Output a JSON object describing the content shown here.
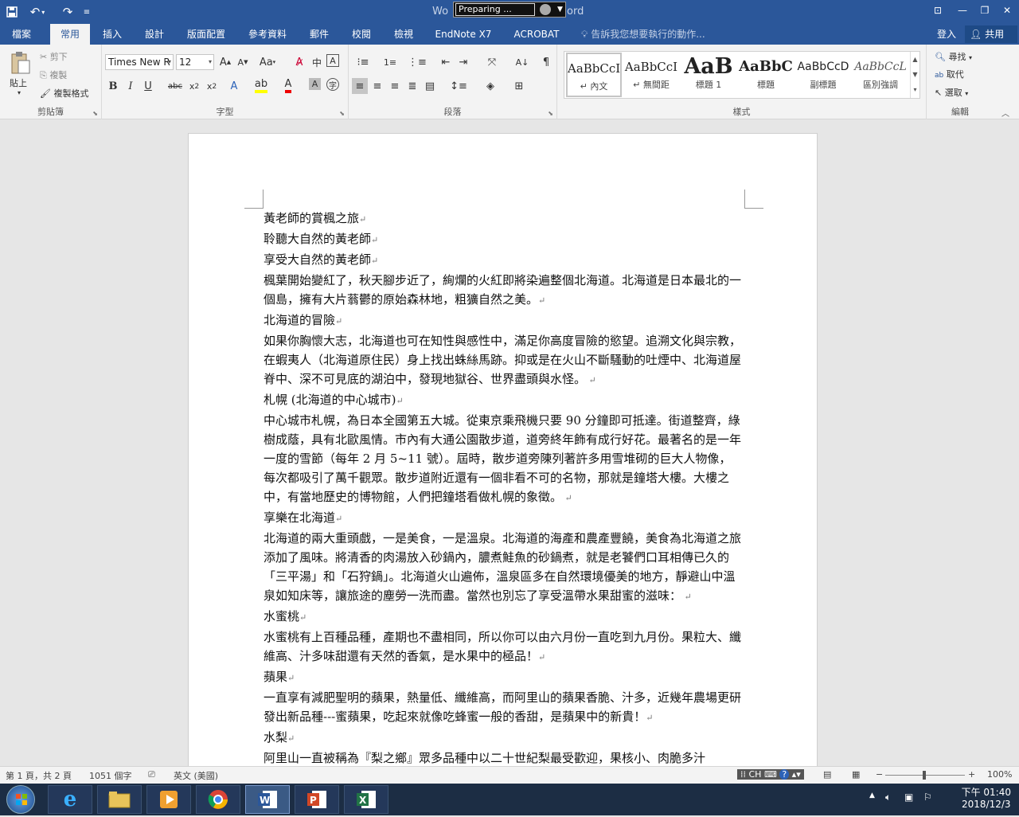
{
  "titlebar": {
    "title_left": "Wo",
    "title_right": "ord",
    "preparing": "Preparing ..."
  },
  "tabs": [
    "檔案",
    "常用",
    "插入",
    "設計",
    "版面配置",
    "參考資料",
    "郵件",
    "校閱",
    "檢視",
    "EndNote X7",
    "ACROBAT"
  ],
  "tell_me": "告訴我您想要執行的動作...",
  "sign_in": "登入",
  "share": "共用",
  "ribbon": {
    "clipboard": {
      "paste": "貼上",
      "cut": "剪下",
      "copy": "複製",
      "format_painter": "複製格式",
      "label": "剪貼簿"
    },
    "font": {
      "name": "Times New R",
      "size": "12",
      "label": "字型"
    },
    "paragraph": {
      "label": "段落"
    },
    "styles": {
      "label": "樣式",
      "items": [
        {
          "preview": "AaBbCcI",
          "name": "↵ 內文"
        },
        {
          "preview": "AaBbCcI",
          "name": "↵ 無間距"
        },
        {
          "preview": "AaB",
          "name": "標題 1"
        },
        {
          "preview": "AaBbC",
          "name": "標題"
        },
        {
          "preview": "AaBbCcD",
          "name": "副標題"
        },
        {
          "preview": "AaBbCcL",
          "name": "區別強調"
        }
      ]
    },
    "editing": {
      "find": "尋找",
      "replace": "取代",
      "select": "選取",
      "label": "編輯"
    }
  },
  "document": {
    "paragraphs": [
      "黃老師的賞楓之旅",
      "聆聽大自然的黃老師",
      "享受大自然的黃老師",
      "楓葉開始變紅了，秋天腳步近了，絢爛的火紅即將染遍整個北海道。北海道是日本最北的一個島，擁有大片蓊鬱的原始森林地，粗獷自然之美。",
      "北海道的冒險",
      "如果你胸懷大志，北海道也可在知性與感性中，滿足你高度冒險的慾望。追溯文化與宗教，在蝦夷人（北海道原住民）身上找出蛛絲馬跡。抑或是在火山不斷騷動的吐煙中、北海道屋脊中、深不可見底的湖泊中，發現地獄谷、世界盡頭與水怪。",
      "札幌 (北海道的中心城市)",
      "中心城市札幌，為日本全國第五大城。從東京乘飛機只要 90 分鐘即可抵達。街道整齊，綠樹成蔭，具有北歐風情。市內有大通公園散步道，道旁終年飾有成行好花。最著名的是一年一度的雪節（每年 2 月 5~11 號）。屆時，散步道旁陳列著許多用雪堆砌的巨大人物像，每次都吸引了萬千觀眾。散步道附近還有一個非看不可的名物，那就是鐘塔大樓。大樓之中，有當地歷史的博物館，人們把鐘塔看做札幌的象徵。",
      "享樂在北海道",
      "北海道的兩大重頭戲，一是美食，一是溫泉。北海道的海產和農產豐饒，美食為北海道之旅添加了風味。將清香的肉湯放入砂鍋內，膿煮鮭魚的砂鍋煮，就是老饕們口耳相傳已久的「三平湯」和「石狩鍋」。北海道火山遍佈，溫泉區多在自然環境優美的地方，靜避山中溫泉如知床等，讓旅途的塵勞一洗而盡。當然也別忘了享受溫帶水果甜蜜的滋味：",
      "水蜜桃",
      "水蜜桃有上百種品種，產期也不盡相同，所以你可以由六月份一直吃到九月份。果粒大、纖維高、汁多味甜還有天然的香氣，是水果中的極品！",
      "蘋果",
      "一直享有減肥聖明的蘋果，熱量低、纖維高，而阿里山的蘋果香脆、汁多，近幾年農場更研發出新品種---蜜蘋果，吃起來就像吃蜂蜜一般的香甜，是蘋果中的新貴！",
      "水梨",
      "阿里山一直被稱為『梨之鄉』眾多品種中以二十世紀梨最受歡迎，果核小、肉脆多汁"
    ]
  },
  "status": {
    "page": "第 1 頁，共 2 頁",
    "words": "1051 個字",
    "language": "英文 (美國)",
    "ime": "CH",
    "zoom": "100%"
  },
  "taskbar": {
    "time": "下午 01:40",
    "date": "2018/12/3"
  },
  "colors": {
    "accent": "#2b579a",
    "taskbar": "#1c2d44"
  }
}
